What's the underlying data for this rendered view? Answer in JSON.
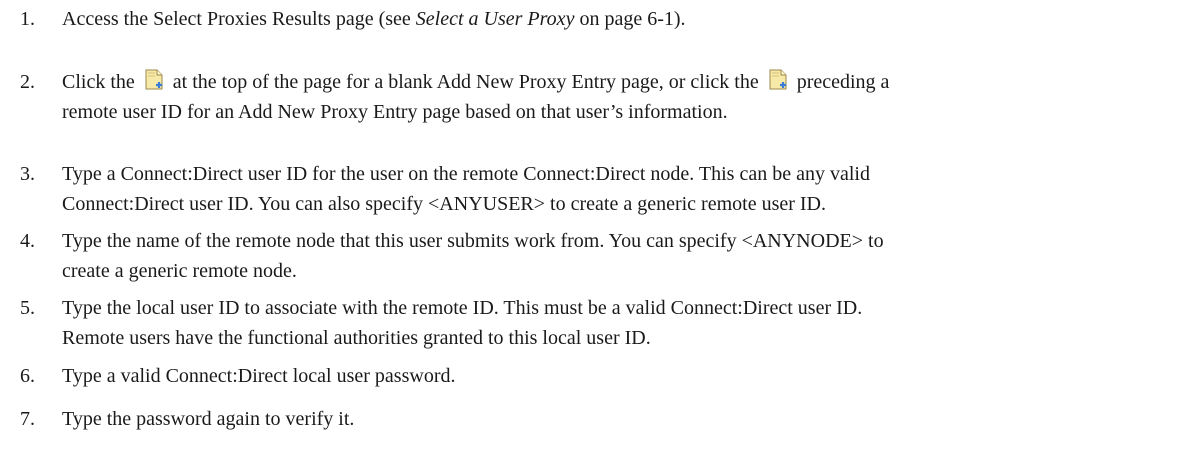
{
  "steps": [
    {
      "number": "1.",
      "before_link": "Access the Select Proxies Results page (see ",
      "link": "Select a User Proxy",
      "after_link": " on page 6-1)."
    },
    {
      "number": "2.",
      "part1": "Click the",
      "part2": "at the top of the page for a blank Add New Proxy Entry page, or click the",
      "part3": "preceding a",
      "line2": "remote user ID for an Add New Proxy Entry page based on that user’s information.",
      "icon": "add-entry-icon"
    },
    {
      "number": "3.",
      "line1": "Type a Connect:Direct user ID for the user on the remote Connect:Direct node. This can be any valid",
      "line2": "Connect:Direct user ID. You can also specify <ANYUSER> to create a generic remote user ID."
    },
    {
      "number": "4.",
      "line1": "Type the name of the remote node that this user submits work from. You can specify <ANYNODE> to",
      "line2": "create a generic remote node."
    },
    {
      "number": "5.",
      "line1": "Type the local user ID to associate with the remote ID. This must be a valid Connect:Direct user ID.",
      "line2": "Remote users have the functional authorities granted to this local user ID."
    },
    {
      "number": "6.",
      "line1": "Type a valid Connect:Direct local user password."
    },
    {
      "number": "7.",
      "line1": "Type the password again to verify it."
    }
  ],
  "colors": {
    "text": "#1a1a1a",
    "icon_fill": "#f7e9a8",
    "icon_accent": "#3a7bd5"
  }
}
